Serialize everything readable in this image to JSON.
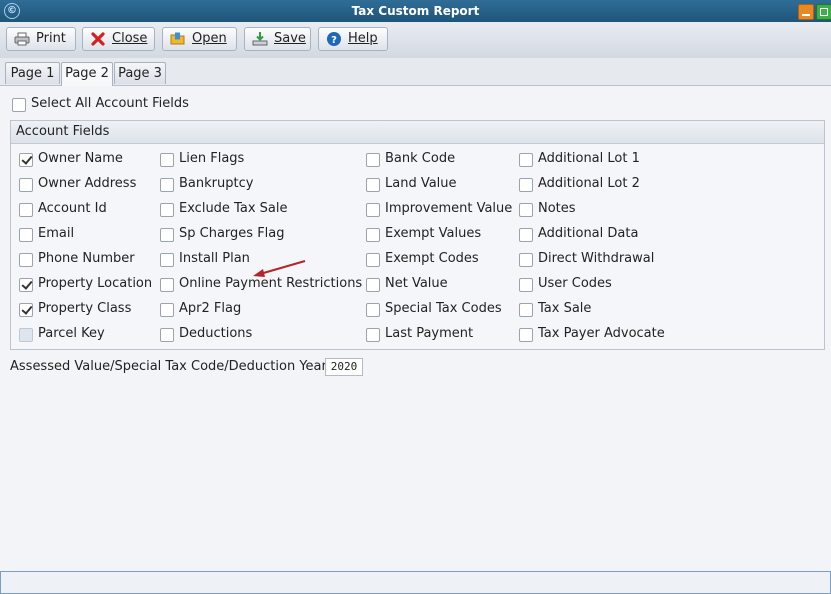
{
  "window": {
    "title": "Tax Custom Report",
    "icon": "app-logo-icon",
    "colors": {
      "titlebar": "#265f86",
      "minimize": "#e78a24",
      "maximize": "#3fae48",
      "arrow": "#b4252a"
    }
  },
  "toolbar": {
    "print": {
      "label": "Print",
      "icon": "printer-icon"
    },
    "close": {
      "label": "Close",
      "icon": "red-x-icon"
    },
    "open": {
      "label": "Open",
      "icon": "folder-icon"
    },
    "save": {
      "label": "Save",
      "icon": "save-download-icon"
    },
    "help": {
      "label": "Help",
      "icon": "help-icon"
    }
  },
  "tabs": [
    {
      "label": "Page 1",
      "active": false
    },
    {
      "label": "Page 2",
      "active": true
    },
    {
      "label": "Page 3",
      "active": false
    }
  ],
  "select_all": {
    "label": "Select All Account Fields",
    "checked": false
  },
  "account_fields": {
    "title": "Account Fields",
    "columns": [
      [
        {
          "label": "Owner Name",
          "checked": true
        },
        {
          "label": "Owner Address",
          "checked": false
        },
        {
          "label": "Account Id",
          "checked": false
        },
        {
          "label": "Email",
          "checked": false
        },
        {
          "label": "Phone Number",
          "checked": false
        },
        {
          "label": "Property Location",
          "checked": true
        },
        {
          "label": "Property Class",
          "checked": true
        },
        {
          "label": "Parcel Key",
          "checked": false,
          "disabled": true
        }
      ],
      [
        {
          "label": "Lien Flags",
          "checked": false
        },
        {
          "label": "Bankruptcy",
          "checked": false
        },
        {
          "label": "Exclude Tax Sale",
          "checked": false
        },
        {
          "label": "Sp Charges Flag",
          "checked": false
        },
        {
          "label": "Install Plan",
          "checked": false
        },
        {
          "label": "Online Payment Restrictions",
          "checked": false
        },
        {
          "label": "Apr2 Flag",
          "checked": false
        },
        {
          "label": "Deductions",
          "checked": false
        }
      ],
      [
        {
          "label": "Bank Code",
          "checked": false
        },
        {
          "label": "Land Value",
          "checked": false
        },
        {
          "label": "Improvement Value",
          "checked": false
        },
        {
          "label": "Exempt Values",
          "checked": false
        },
        {
          "label": "Exempt Codes",
          "checked": false
        },
        {
          "label": "Net Value",
          "checked": false
        },
        {
          "label": "Special Tax Codes",
          "checked": false
        },
        {
          "label": "Last Payment",
          "checked": false
        }
      ],
      [
        {
          "label": "Additional Lot 1",
          "checked": false
        },
        {
          "label": "Additional Lot 2",
          "checked": false
        },
        {
          "label": "Notes",
          "checked": false
        },
        {
          "label": "Additional Data",
          "checked": false
        },
        {
          "label": "Direct Withdrawal",
          "checked": false
        },
        {
          "label": "User Codes",
          "checked": false
        },
        {
          "label": "Tax Sale",
          "checked": false
        },
        {
          "label": "Tax Payer Advocate",
          "checked": false
        }
      ]
    ]
  },
  "year_field": {
    "label": "Assessed Value/Special Tax Code/Deduction Year:",
    "value": "2020"
  }
}
